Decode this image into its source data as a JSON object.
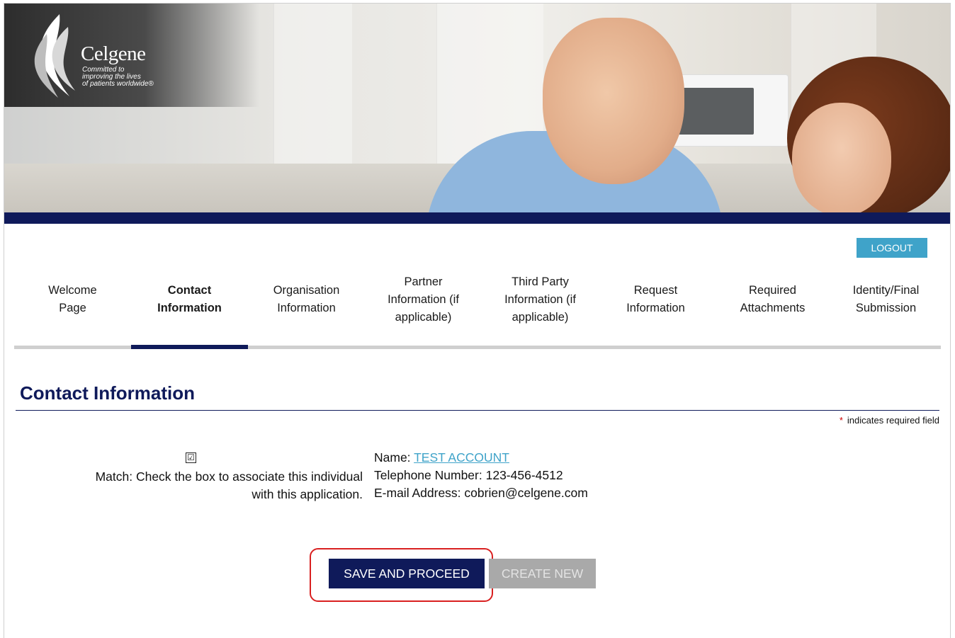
{
  "brand": {
    "wordmark": "Celgene",
    "tagline_lines": [
      "Committed to",
      "improving the lives",
      "of patients worldwide®"
    ]
  },
  "header": {
    "logout_label": "LOGOUT"
  },
  "tabs": [
    {
      "lines": [
        "Welcome",
        "Page"
      ]
    },
    {
      "lines": [
        "Contact",
        "Information"
      ],
      "active": true
    },
    {
      "lines": [
        "Organisation",
        "Information"
      ]
    },
    {
      "lines": [
        "Partner",
        "Information (if",
        "applicable)"
      ]
    },
    {
      "lines": [
        "Third Party",
        "Information (if",
        "applicable)"
      ]
    },
    {
      "lines": [
        "Request",
        "Information"
      ]
    },
    {
      "lines": [
        "Required",
        "Attachments"
      ]
    },
    {
      "lines": [
        "Identity/Final",
        "Submission"
      ]
    }
  ],
  "section": {
    "title": "Contact Information",
    "required_star": "*",
    "required_note": "indicates required field"
  },
  "match": {
    "checked": true,
    "checkbox_glyph": "☑",
    "line1": "Match:  Check the box to associate this individual",
    "line2": "with this application."
  },
  "contact": {
    "name_label": "Name:",
    "name_value": "TEST ACCOUNT",
    "phone_label": "Telephone Number:",
    "phone_value": "123-456-4512",
    "email_label": "E-mail Address:",
    "email_value": "cobrien@celgene.com"
  },
  "buttons": {
    "save_label": "SAVE AND PROCEED",
    "create_label": "CREATE NEW"
  },
  "colors": {
    "navy": "#0f1a5a",
    "accent_blue": "#3fa3c9",
    "highlight_red": "#d92020",
    "disabled_gray": "#a9a9a9"
  }
}
